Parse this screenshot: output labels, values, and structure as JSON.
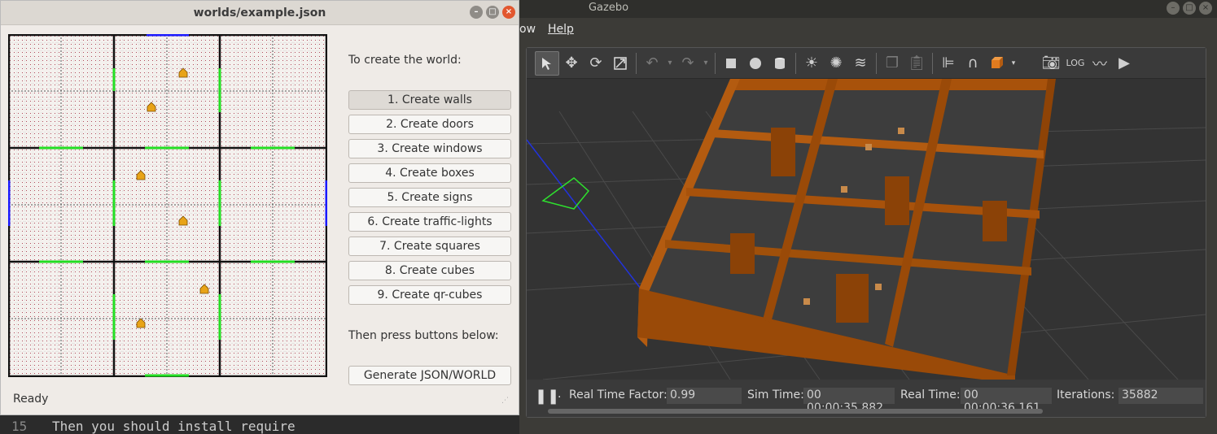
{
  "gazebo": {
    "title": "Gazebo",
    "menus": [
      "ow",
      "Help"
    ],
    "stats": {
      "rtf_label": "Real Time Factor:",
      "rtf_value": "0.99",
      "sim_label": "Sim Time:",
      "sim_value": "00 00:00:35.882",
      "real_label": "Real Time:",
      "real_value": "00 00:00:36.161",
      "iter_label": "Iterations:",
      "iter_value": "35882"
    },
    "toolbar_icons": [
      "select-arrow-icon",
      "translate-icon",
      "rotate-icon",
      "scale-icon",
      "undo-icon",
      "undo-dropdown-icon",
      "redo-icon",
      "redo-dropdown-icon",
      "box-icon",
      "sphere-icon",
      "cylinder-icon",
      "point-light-icon",
      "spot-light-icon",
      "directional-light-icon",
      "copy-icon",
      "paste-icon",
      "align-icon",
      "magnet-icon",
      "view-angle-icon",
      "screenshot-icon",
      "log-icon",
      "plot-icon",
      "video-record-icon"
    ]
  },
  "editor": {
    "line_number": "15",
    "line_text": "Then you should install require"
  },
  "dialog": {
    "title": "worlds/example.json",
    "intro": "To create the world:",
    "buttons": [
      "1. Create walls",
      "2. Create doors",
      "3. Create windows",
      "4. Create boxes",
      "5. Create signs",
      "6. Create traffic-lights",
      "7. Create squares",
      "8. Create cubes",
      "9. Create qr-cubes"
    ],
    "then_label": "Then press buttons below:",
    "generate_button": "Generate JSON/WORLD",
    "status": "Ready"
  },
  "colors": {
    "wall": "#000000",
    "door": "#22dd22",
    "window": "#1a1aff",
    "box": "#e8a317",
    "gazebo_wall": "#a8520b"
  }
}
